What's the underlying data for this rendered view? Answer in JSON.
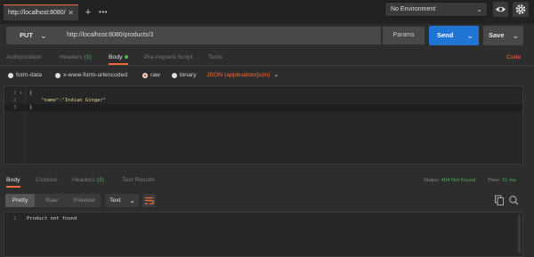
{
  "tabs": [
    {
      "label": "http://localhost:8080/"
    }
  ],
  "environment": {
    "selected": "No Environment"
  },
  "request": {
    "method": "PUT",
    "url": "http://localhost:8080/products/3",
    "params_label": "Params",
    "send_label": "Send",
    "save_label": "Save"
  },
  "request_tabs": {
    "authorization": "Authorization",
    "headers": "Headers",
    "headers_count": "(1)",
    "body": "Body",
    "prerequest": "Pre-request Script",
    "tests": "Tests",
    "code": "Code"
  },
  "body_types": {
    "form_data": "form-data",
    "urlencoded": "x-www-form-urlencoded",
    "raw": "raw",
    "binary": "binary",
    "content_type": "JSON (application/json)"
  },
  "editor": {
    "lines": [
      {
        "num": "1",
        "text": "{"
      },
      {
        "num": "2",
        "key": "\"name\"",
        "sep": ":",
        "value": "\"Indian Ginger\""
      },
      {
        "num": "3",
        "text": "}"
      }
    ]
  },
  "response": {
    "tabs": {
      "body": "Body",
      "cookies": "Cookies",
      "headers": "Headers",
      "headers_count": "(3)",
      "test_results": "Test Results"
    },
    "status_label": "Status:",
    "status_value": "404 Not Found",
    "time_label": "Time:",
    "time_value": "31 ms",
    "formats": {
      "pretty": "Pretty",
      "raw": "Raw",
      "preview": "Preview"
    },
    "text_type": "Text",
    "lines": [
      {
        "num": "1",
        "text": "Product not found"
      }
    ]
  },
  "colors": {
    "accent": "#f26b3a",
    "send": "#1f74d4",
    "success_green": "#4caf50"
  }
}
